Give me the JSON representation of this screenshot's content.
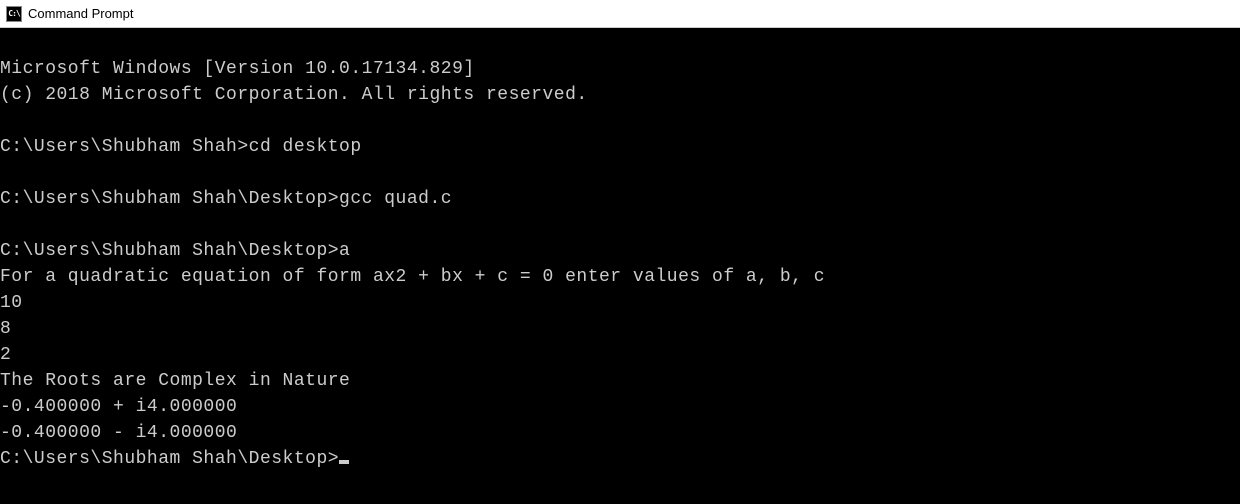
{
  "window": {
    "title": "Command Prompt",
    "icon_label": "C:\\"
  },
  "terminal": {
    "lines": [
      "Microsoft Windows [Version 10.0.17134.829]",
      "(c) 2018 Microsoft Corporation. All rights reserved.",
      "",
      "C:\\Users\\Shubham Shah>cd desktop",
      "",
      "C:\\Users\\Shubham Shah\\Desktop>gcc quad.c",
      "",
      "C:\\Users\\Shubham Shah\\Desktop>a",
      "For a quadratic equation of form ax2 + bx + c = 0 enter values of a, b, c",
      "10",
      "8",
      "2",
      "The Roots are Complex in Nature",
      "-0.400000 + i4.000000",
      "-0.400000 - i4.000000"
    ],
    "current_prompt": "C:\\Users\\Shubham Shah\\Desktop>"
  }
}
